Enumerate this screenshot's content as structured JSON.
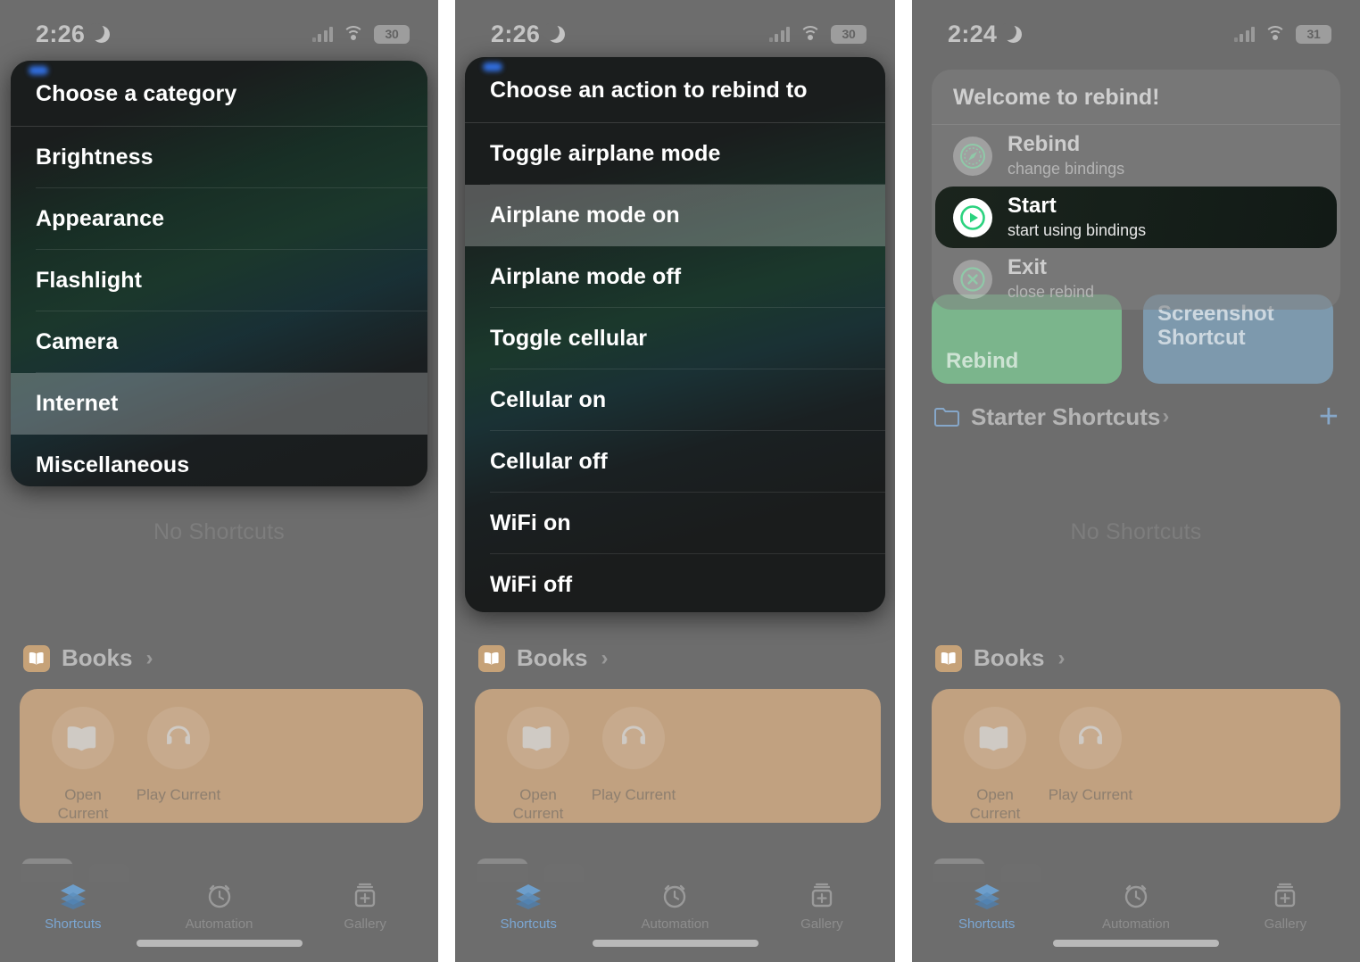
{
  "panels": [
    {
      "status": {
        "time": "2:26",
        "moon_icon": "moon-icon",
        "signal_icon": "cellular-bars-icon",
        "wifi_icon": "wifi-icon",
        "battery": "30"
      },
      "menu": {
        "header": "Choose a category",
        "items": [
          {
            "label": "Brightness",
            "selected": false
          },
          {
            "label": "Appearance",
            "selected": false
          },
          {
            "label": "Flashlight",
            "selected": false
          },
          {
            "label": "Camera",
            "selected": false
          },
          {
            "label": "Internet",
            "selected": true
          },
          {
            "label": "Miscellaneous",
            "selected": false
          }
        ]
      }
    },
    {
      "status": {
        "time": "2:26",
        "moon_icon": "moon-icon",
        "signal_icon": "cellular-bars-icon",
        "wifi_icon": "wifi-icon",
        "battery": "30"
      },
      "menu": {
        "header": "Choose an action to rebind to",
        "items": [
          {
            "label": "Toggle airplane mode",
            "selected": false
          },
          {
            "label": "Airplane mode on",
            "selected": true
          },
          {
            "label": "Airplane mode off",
            "selected": false
          },
          {
            "label": "Toggle cellular",
            "selected": false
          },
          {
            "label": "Cellular on",
            "selected": false
          },
          {
            "label": "Cellular off",
            "selected": false
          },
          {
            "label": "WiFi on",
            "selected": false
          },
          {
            "label": "WiFi off",
            "selected": false
          }
        ]
      }
    },
    {
      "status": {
        "time": "2:24",
        "moon_icon": "moon-icon",
        "signal_icon": "cellular-bars-icon",
        "wifi_icon": "wifi-icon",
        "battery": "31"
      },
      "dialog": {
        "header": "Welcome to rebind!",
        "rows": [
          {
            "title": "Rebind",
            "subtitle": "change bindings",
            "icon": "compass-icon",
            "selected": false
          },
          {
            "title": "Start",
            "subtitle": "start using bindings",
            "icon": "play-circle-icon",
            "selected": true
          },
          {
            "title": "Exit",
            "subtitle": "close rebind",
            "icon": "x-circle-icon",
            "selected": false
          }
        ]
      },
      "shortcut_tiles": [
        {
          "label": "Rebind",
          "color": "#7bb58c"
        },
        {
          "label": "Screenshot Shortcut",
          "color": "#7d99ad"
        }
      ],
      "starter_folder": {
        "label": "Starter Shortcuts",
        "chevron": "chevron-right-icon",
        "add": "plus-icon",
        "folder_icon": "folder-icon"
      }
    }
  ],
  "page": {
    "empty_state": "No Shortcuts",
    "books": {
      "title": "Books",
      "chevron": "chevron-right-icon",
      "app_icon": "books-app-icon",
      "actions": [
        {
          "label": "Open Current",
          "icon": "open-book-icon"
        },
        {
          "label": "Play Current",
          "icon": "headphones-icon"
        }
      ]
    },
    "tabs": [
      {
        "label": "Shortcuts",
        "icon": "layers-icon",
        "active": true
      },
      {
        "label": "Automation",
        "icon": "clock-icon",
        "active": false
      },
      {
        "label": "Gallery",
        "icon": "gallery-icon",
        "active": false
      }
    ]
  },
  "colors": {
    "accent_blue": "#3478f6",
    "tab_active": "#7ba7d4",
    "menu_bg": "#1d1f1f",
    "selected_green": "#2bd37f",
    "books_tint": "#c1a180"
  }
}
